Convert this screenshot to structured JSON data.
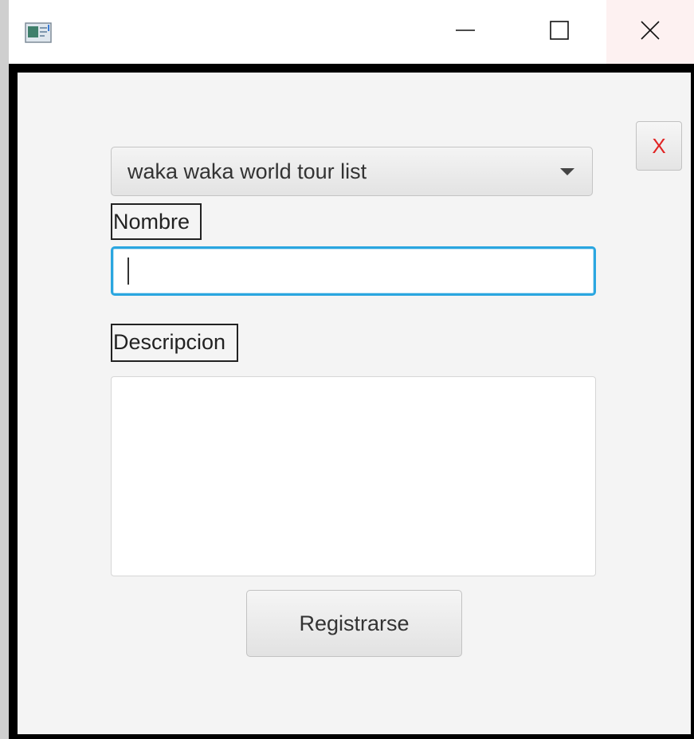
{
  "window": {
    "title_bar": {
      "app_icon": "app-window-icon",
      "minimize_icon": "minimize-icon",
      "maximize_icon": "maximize-icon",
      "close_icon": "close-icon"
    }
  },
  "form": {
    "close_button_label": "X",
    "list_select": {
      "selected_value": "waka waka world tour list",
      "icon": "chevron-down-icon"
    },
    "name_label": "Nombre",
    "name_input": {
      "value": ""
    },
    "description_label": "Descripcion",
    "description_input": {
      "value": ""
    },
    "register_button_label": "Registrarse"
  },
  "colors": {
    "focus_accent": "#2aa6e0",
    "close_button_text": "#e02424",
    "frame_border": "#000000"
  }
}
